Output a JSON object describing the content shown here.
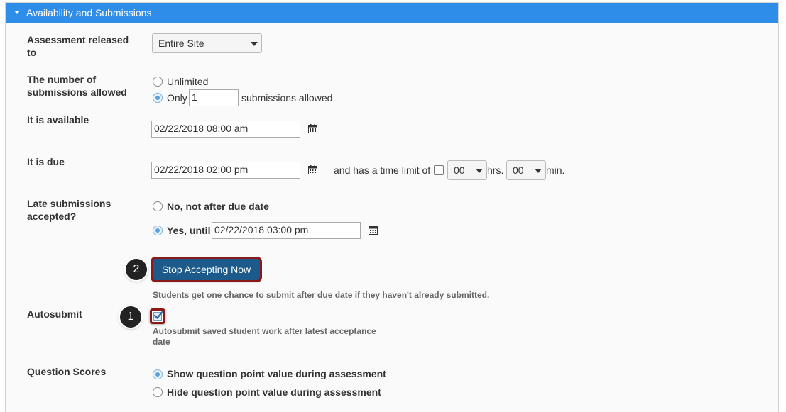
{
  "panel": {
    "title": "Availability and Submissions"
  },
  "released": {
    "label": "Assessment released to",
    "value": "Entire Site"
  },
  "submissions": {
    "label": "The number of submissions allowed",
    "unlimited_label": "Unlimited",
    "only_label": "Only",
    "count_value": "1",
    "suffix": "submissions allowed",
    "selected": "only"
  },
  "available": {
    "label": "It is available",
    "value": "02/22/2018 08:00 am"
  },
  "due": {
    "label": "It is due",
    "value": "02/22/2018 02:00 pm",
    "time_limit_label": "and has a time limit of",
    "hours_value": "00",
    "hours_label": "hrs.",
    "minutes_value": "00",
    "minutes_label": "min."
  },
  "late": {
    "label": "Late submissions accepted?",
    "no_label": "No, not after due date",
    "yes_label": "Yes, until",
    "until_value": "02/22/2018 03:00 pm",
    "selected": "yes"
  },
  "stop": {
    "button_label": "Stop Accepting Now",
    "marker": "2",
    "help": "Students get one chance to submit after due date if they haven't already submitted."
  },
  "autosubmit": {
    "label": "Autosubmit",
    "marker": "1",
    "checked": true,
    "help_line1": "Autosubmit saved student work after latest acceptance",
    "help_line2": "date"
  },
  "scores": {
    "label": "Question Scores",
    "show_label": "Show question point value during assessment",
    "hide_label": "Hide question point value during assessment",
    "selected": "show"
  },
  "colors": {
    "header": "#2f8dea",
    "button": "#1b5a8a",
    "highlight": "#8a1a1a"
  },
  "icons": [
    "chevron-down-icon",
    "calendar-icon",
    "checkmark-icon"
  ]
}
